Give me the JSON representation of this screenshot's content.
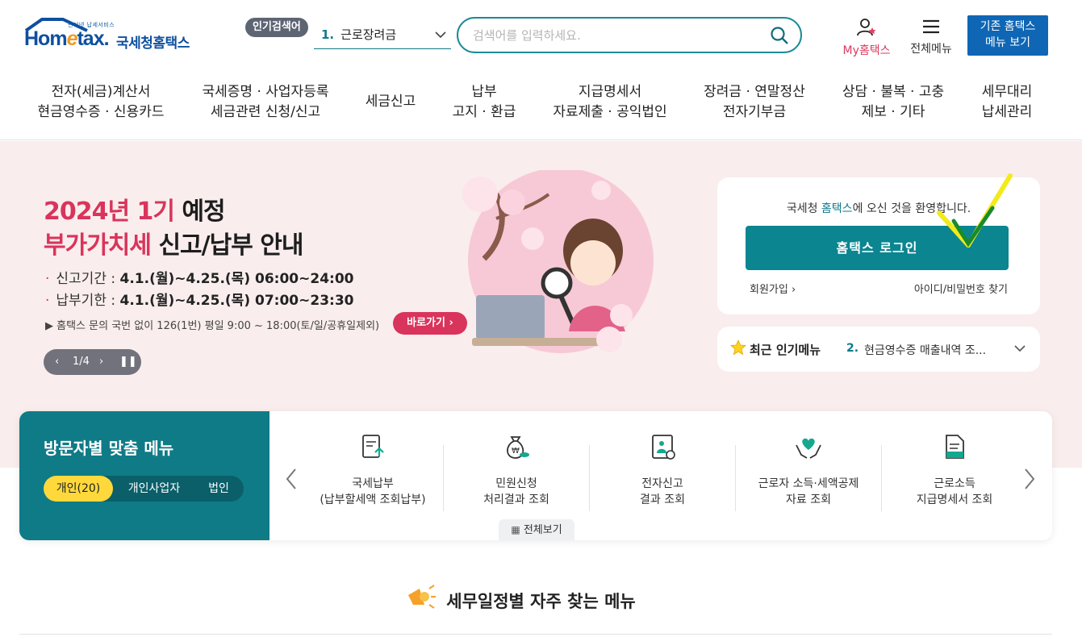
{
  "header": {
    "logo_sub": "인터넷 납세서비스",
    "logo_text_pre": "Hom",
    "logo_text_e": "e",
    "logo_text_post": "tax.",
    "logo_name": "국세청홈택스",
    "popular_tag": "인기검색어",
    "popular_rank": "1.",
    "popular_keyword": "근로장려금",
    "search_placeholder": "검색어를 입력하세요.",
    "my_hometax": "My홈택스",
    "all_menu": "전체메뉴",
    "old_menu_line1": "기존 홈택스",
    "old_menu_line2": "메뉴 보기"
  },
  "gnb": [
    {
      "l1": "전자(세금)계산서",
      "l2": "현금영수증 · 신용카드"
    },
    {
      "l1": "국세증명 · 사업자등록",
      "l2": "세금관련 신청/신고"
    },
    {
      "l1": "세금신고",
      "l2": ""
    },
    {
      "l1": "납부",
      "l2": "고지 · 환급"
    },
    {
      "l1": "지급명세서",
      "l2": "자료제출 · 공익법인"
    },
    {
      "l1": "장려금 · 연말정산",
      "l2": "전자기부금"
    },
    {
      "l1": "상담 · 불복 · 고충",
      "l2": "제보 · 기타"
    },
    {
      "l1": "세무대리",
      "l2": "납세관리"
    }
  ],
  "hero": {
    "title1_pink": "2024년 1기",
    "title1_dark": " 예정",
    "title2_pink": "부가가치세",
    "title2_dark": " 신고/납부 안내",
    "line1_label": "신고기간 :",
    "line1_value": "4.1.(월)~4.25.(목) 06:00~24:00",
    "line2_label": "납부기한 :",
    "line2_value": "4.1.(월)~4.25.(목) 07:00~23:30",
    "note": "▶ 홈택스 문의 국번 없이 126(1번) 평일 9:00 ~ 18:00(토/일/공휴일제외)",
    "go_button": "바로가기",
    "pager": "1/4"
  },
  "login": {
    "welcome_pre": "국세청 ",
    "welcome_brand": "홈택스",
    "welcome_post": "에 오신 것을 환영합니다.",
    "login_button": "홈택스 로그인",
    "join": "회원가입",
    "find": "아이디/비밀번호 찾기"
  },
  "recent": {
    "title": "최근 인기메뉴",
    "rank": "2.",
    "value": "현금영수증 매출내역 조..."
  },
  "visitor": {
    "title": "방문자별 맞춤 메뉴",
    "tabs": [
      "개인(20)",
      "개인사업자",
      "법인"
    ],
    "services": [
      {
        "l1": "국세납부",
        "l2": "(납부할세액 조회납부)",
        "icon": "tax-payment-icon"
      },
      {
        "l1": "민원신청",
        "l2": "처리결과 조회",
        "icon": "money-bag-icon"
      },
      {
        "l1": "전자신고",
        "l2": "결과 조회",
        "icon": "e-filing-icon"
      },
      {
        "l1": "근로자 소득·세액공제",
        "l2": "자료 조회",
        "icon": "heart-hands-icon"
      },
      {
        "l1": "근로소득",
        "l2": "지급명세서 조회",
        "icon": "document-icon"
      }
    ],
    "view_all": "전체보기"
  },
  "section": {
    "title": "세무일정별 자주 찾는 메뉴"
  },
  "colors": {
    "teal": "#0b8590",
    "pink": "#d9345b",
    "blue": "#0f66b4",
    "yellow": "#ffd93b"
  }
}
